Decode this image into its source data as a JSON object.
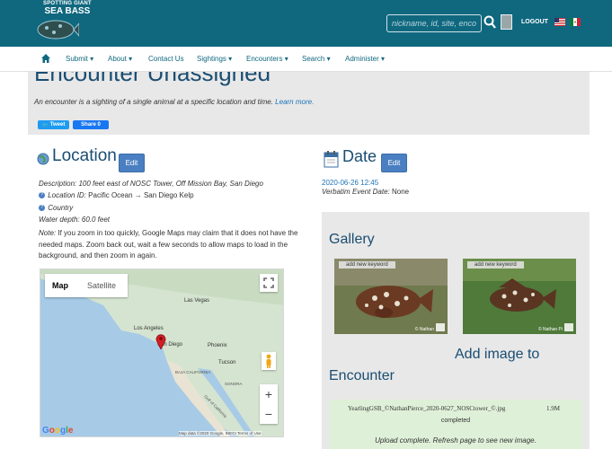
{
  "header": {
    "logo_line1": "SPOTTING GIANT",
    "logo_line2": "SEA BASS",
    "search_placeholder": "nickname, id, site, encounter",
    "logout_label": "LOGOUT",
    "colors": {
      "bar": "#10687f",
      "accent": "#1a4d72"
    }
  },
  "nav": {
    "items": [
      "Submit",
      "About",
      "Contact Us",
      "Sightings",
      "Encounters",
      "Search",
      "Administer"
    ]
  },
  "banner": {
    "title": "Encounter Unassigned",
    "subtitle": "An encounter is a sighting of a single animal at a specific location and time.",
    "learn_more": "Learn more.",
    "tweet": "Tweet",
    "share": "Share 0"
  },
  "location": {
    "title": "Location",
    "edit_label": "Edit",
    "description_label": "Description:",
    "description_value": "100 feet east of NOSC Tower, Off Mission Bay, San Diego",
    "location_id_label": "Location ID:",
    "location_id_value": "Pacific Ocean → San Diego Kelp",
    "country_label": "Country",
    "water_depth_label": "Water depth:",
    "water_depth_value": "60.0 feet",
    "note_label": "Note:",
    "note_text": "If you zoom in too quickly, Google Maps may claim that it does not have the needed maps. Zoom back out, wait a few seconds to allow maps to load in the background, and then zoom in again."
  },
  "map": {
    "tab_map": "Map",
    "tab_satellite": "Satellite",
    "labels": [
      "Las Vegas",
      "Los Angeles",
      "San Diego",
      "Phoenix",
      "Tucson",
      "BAJA CALIFORNIA",
      "SONORA",
      "Gulf of California"
    ],
    "attribution": "Map data ©2020 Google, INEGI   Terms of Use",
    "google": "Google"
  },
  "date": {
    "title": "Date",
    "edit_label": "Edit",
    "value": "2020-06-26 12:45",
    "verbatim_label": "Verbatim Event Date:",
    "verbatim_value": "None"
  },
  "gallery": {
    "title": "Gallery",
    "keyword_button": "add new keyword",
    "photo1_credit": "© Nathan",
    "photo2_credit": "© Nathan Pi",
    "add_image_line1": "Add image to",
    "add_image_line2": "Encounter",
    "upload_filename": "YearlingGSB_©NathanPierce_2020-0627_NOSCtower_©.jpg",
    "upload_size": "1.9M",
    "upload_status": "completed",
    "upload_message": "Upload complete. Refresh page to see new image."
  }
}
